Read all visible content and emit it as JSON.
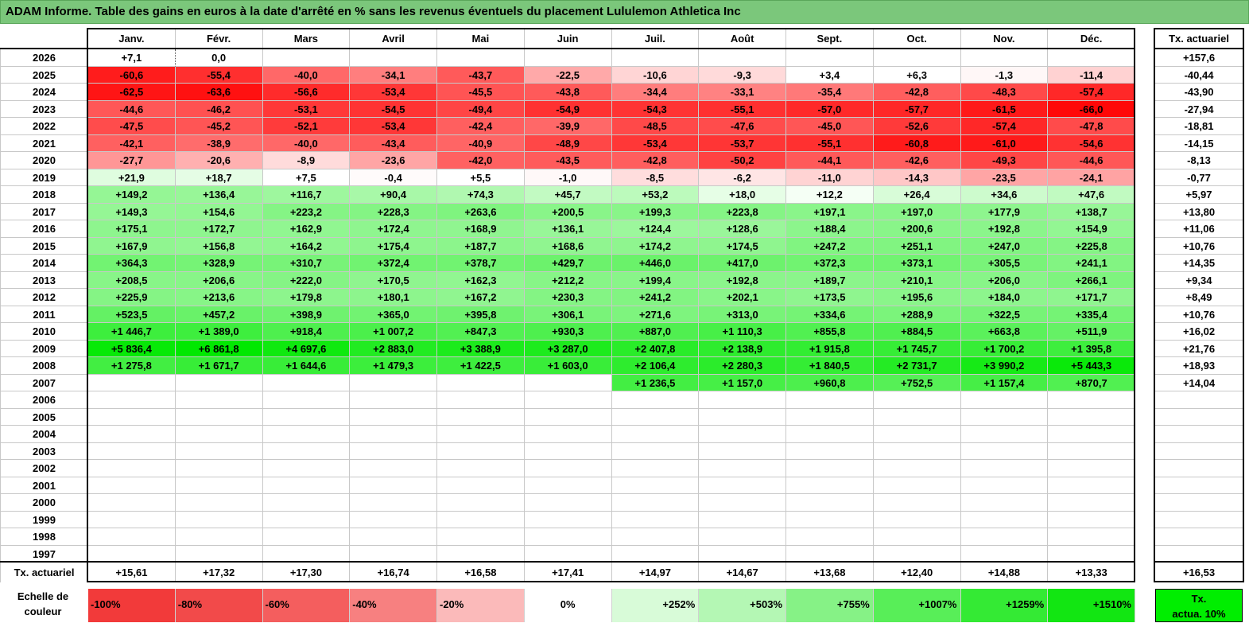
{
  "title": "ADAM Informe. Table des gains en euros à la date d'arrêté en % sans les revenus éventuels du placement Lululemon Athletica Inc",
  "months": [
    "Janv.",
    "Févr.",
    "Mars",
    "Avril",
    "Mai",
    "Juin",
    "Juil.",
    "Août",
    "Sept.",
    "Oct.",
    "Nov.",
    "Déc."
  ],
  "tx_header": "Tx. actuariel",
  "rows": [
    {
      "year": "2026",
      "values": [
        "+7,1",
        "0,0",
        "",
        "",
        "",
        "",
        "",
        "",
        "",
        "",
        "",
        ""
      ],
      "tx": "+157,6"
    },
    {
      "year": "2025",
      "values": [
        "-60,6",
        "-55,4",
        "-40,0",
        "-34,1",
        "-43,7",
        "-22,5",
        "-10,6",
        "-9,3",
        "+3,4",
        "+6,3",
        "-1,3",
        "-11,4"
      ],
      "tx": "-40,44"
    },
    {
      "year": "2024",
      "values": [
        "-62,5",
        "-63,6",
        "-56,6",
        "-53,4",
        "-45,5",
        "-43,8",
        "-34,4",
        "-33,1",
        "-35,4",
        "-42,8",
        "-48,3",
        "-57,4"
      ],
      "tx": "-43,90"
    },
    {
      "year": "2023",
      "values": [
        "-44,6",
        "-46,2",
        "-53,1",
        "-54,5",
        "-49,4",
        "-54,9",
        "-54,3",
        "-55,1",
        "-57,0",
        "-57,7",
        "-61,5",
        "-66,0"
      ],
      "tx": "-27,94"
    },
    {
      "year": "2022",
      "values": [
        "-47,5",
        "-45,2",
        "-52,1",
        "-53,4",
        "-42,4",
        "-39,9",
        "-48,5",
        "-47,6",
        "-45,0",
        "-52,6",
        "-57,4",
        "-47,8"
      ],
      "tx": "-18,81"
    },
    {
      "year": "2021",
      "values": [
        "-42,1",
        "-38,9",
        "-40,0",
        "-43,4",
        "-40,9",
        "-48,9",
        "-53,4",
        "-53,7",
        "-55,1",
        "-60,8",
        "-61,0",
        "-54,6"
      ],
      "tx": "-14,15"
    },
    {
      "year": "2020",
      "values": [
        "-27,7",
        "-20,6",
        "-8,9",
        "-23,6",
        "-42,0",
        "-43,5",
        "-42,8",
        "-50,2",
        "-44,1",
        "-42,6",
        "-49,3",
        "-44,6"
      ],
      "tx": "-8,13"
    },
    {
      "year": "2019",
      "values": [
        "+21,9",
        "+18,7",
        "+7,5",
        "-0,4",
        "+5,5",
        "-1,0",
        "-8,5",
        "-6,2",
        "-11,0",
        "-14,3",
        "-23,5",
        "-24,1"
      ],
      "tx": "-0,77"
    },
    {
      "year": "2018",
      "values": [
        "+149,2",
        "+136,4",
        "+116,7",
        "+90,4",
        "+74,3",
        "+45,7",
        "+53,2",
        "+18,0",
        "+12,2",
        "+26,4",
        "+34,6",
        "+47,6"
      ],
      "tx": "+5,97"
    },
    {
      "year": "2017",
      "values": [
        "+149,3",
        "+154,6",
        "+223,2",
        "+228,3",
        "+263,6",
        "+200,5",
        "+199,3",
        "+223,8",
        "+197,1",
        "+197,0",
        "+177,9",
        "+138,7"
      ],
      "tx": "+13,80"
    },
    {
      "year": "2016",
      "values": [
        "+175,1",
        "+172,7",
        "+162,9",
        "+172,4",
        "+168,9",
        "+136,1",
        "+124,4",
        "+128,6",
        "+188,4",
        "+200,6",
        "+192,8",
        "+154,9"
      ],
      "tx": "+11,06"
    },
    {
      "year": "2015",
      "values": [
        "+167,9",
        "+156,8",
        "+164,2",
        "+175,4",
        "+187,7",
        "+168,6",
        "+174,2",
        "+174,5",
        "+247,2",
        "+251,1",
        "+247,0",
        "+225,8"
      ],
      "tx": "+10,76"
    },
    {
      "year": "2014",
      "values": [
        "+364,3",
        "+328,9",
        "+310,7",
        "+372,4",
        "+378,7",
        "+429,7",
        "+446,0",
        "+417,0",
        "+372,3",
        "+373,1",
        "+305,5",
        "+241,1"
      ],
      "tx": "+14,35"
    },
    {
      "year": "2013",
      "values": [
        "+208,5",
        "+206,6",
        "+222,0",
        "+170,5",
        "+162,3",
        "+212,2",
        "+199,4",
        "+192,8",
        "+189,7",
        "+210,1",
        "+206,0",
        "+266,1"
      ],
      "tx": "+9,34"
    },
    {
      "year": "2012",
      "values": [
        "+225,9",
        "+213,6",
        "+179,8",
        "+180,1",
        "+167,2",
        "+230,3",
        "+241,2",
        "+202,1",
        "+173,5",
        "+195,6",
        "+184,0",
        "+171,7"
      ],
      "tx": "+8,49"
    },
    {
      "year": "2011",
      "values": [
        "+523,5",
        "+457,2",
        "+398,9",
        "+365,0",
        "+395,8",
        "+306,1",
        "+271,6",
        "+313,0",
        "+334,6",
        "+288,9",
        "+322,5",
        "+335,4"
      ],
      "tx": "+10,76"
    },
    {
      "year": "2010",
      "values": [
        "+1 446,7",
        "+1 389,0",
        "+918,4",
        "+1 007,2",
        "+847,3",
        "+930,3",
        "+887,0",
        "+1 110,3",
        "+855,8",
        "+884,5",
        "+663,8",
        "+511,9"
      ],
      "tx": "+16,02"
    },
    {
      "year": "2009",
      "values": [
        "+5 836,4",
        "+6 861,8",
        "+4 697,6",
        "+2 883,0",
        "+3 388,9",
        "+3 287,0",
        "+2 407,8",
        "+2 138,9",
        "+1 915,8",
        "+1 745,7",
        "+1 700,2",
        "+1 395,8"
      ],
      "tx": "+21,76"
    },
    {
      "year": "2008",
      "values": [
        "+1 275,8",
        "+1 671,7",
        "+1 644,6",
        "+1 479,3",
        "+1 422,5",
        "+1 603,0",
        "+2 106,4",
        "+2 280,3",
        "+1 840,5",
        "+2 731,7",
        "+3 990,2",
        "+5 443,3"
      ],
      "tx": "+18,93"
    },
    {
      "year": "2007",
      "values": [
        "",
        "",
        "",
        "",
        "",
        "",
        "+1 236,5",
        "+1 157,0",
        "+960,8",
        "+752,5",
        "+1 157,4",
        "+870,7"
      ],
      "tx": "+14,04"
    },
    {
      "year": "2006",
      "values": [
        "",
        "",
        "",
        "",
        "",
        "",
        "",
        "",
        "",
        "",
        "",
        ""
      ],
      "tx": ""
    },
    {
      "year": "2005",
      "values": [
        "",
        "",
        "",
        "",
        "",
        "",
        "",
        "",
        "",
        "",
        "",
        ""
      ],
      "tx": ""
    },
    {
      "year": "2004",
      "values": [
        "",
        "",
        "",
        "",
        "",
        "",
        "",
        "",
        "",
        "",
        "",
        ""
      ],
      "tx": ""
    },
    {
      "year": "2003",
      "values": [
        "",
        "",
        "",
        "",
        "",
        "",
        "",
        "",
        "",
        "",
        "",
        ""
      ],
      "tx": ""
    },
    {
      "year": "2002",
      "values": [
        "",
        "",
        "",
        "",
        "",
        "",
        "",
        "",
        "",
        "",
        "",
        ""
      ],
      "tx": ""
    },
    {
      "year": "2001",
      "values": [
        "",
        "",
        "",
        "",
        "",
        "",
        "",
        "",
        "",
        "",
        "",
        ""
      ],
      "tx": ""
    },
    {
      "year": "2000",
      "values": [
        "",
        "",
        "",
        "",
        "",
        "",
        "",
        "",
        "",
        "",
        "",
        ""
      ],
      "tx": ""
    },
    {
      "year": "1999",
      "values": [
        "",
        "",
        "",
        "",
        "",
        "",
        "",
        "",
        "",
        "",
        "",
        ""
      ],
      "tx": ""
    },
    {
      "year": "1998",
      "values": [
        "",
        "",
        "",
        "",
        "",
        "",
        "",
        "",
        "",
        "",
        "",
        ""
      ],
      "tx": ""
    },
    {
      "year": "1997",
      "values": [
        "",
        "",
        "",
        "",
        "",
        "",
        "",
        "",
        "",
        "",
        "",
        ""
      ],
      "tx": ""
    }
  ],
  "footer": {
    "label": "Tx. actuariel",
    "values": [
      "+15,61",
      "+17,32",
      "+17,30",
      "+16,74",
      "+16,58",
      "+17,41",
      "+14,97",
      "+14,67",
      "+13,68",
      "+12,40",
      "+14,88",
      "+13,33"
    ],
    "total": "+16,53"
  },
  "scale": {
    "label_line1": "Echelle de",
    "label_line2": "couleur",
    "steps": [
      "-100%",
      "-80%",
      "-60%",
      "-40%",
      "-20%",
      "0%",
      "+252%",
      "+503%",
      "+755%",
      "+1007%",
      "+1259%",
      "+1510%"
    ],
    "colors": [
      "#f23a3a",
      "#f24a4a",
      "#f45e5e",
      "#f78080",
      "#fbbaba",
      "#ffffff",
      "#d8fbd8",
      "#b4f7b4",
      "#86f286",
      "#58ee58",
      "#34ea34",
      "#12e612"
    ],
    "tx_line1": "Tx.",
    "tx_line2": "actua. 10%",
    "tx_color": "#00ee00"
  }
}
